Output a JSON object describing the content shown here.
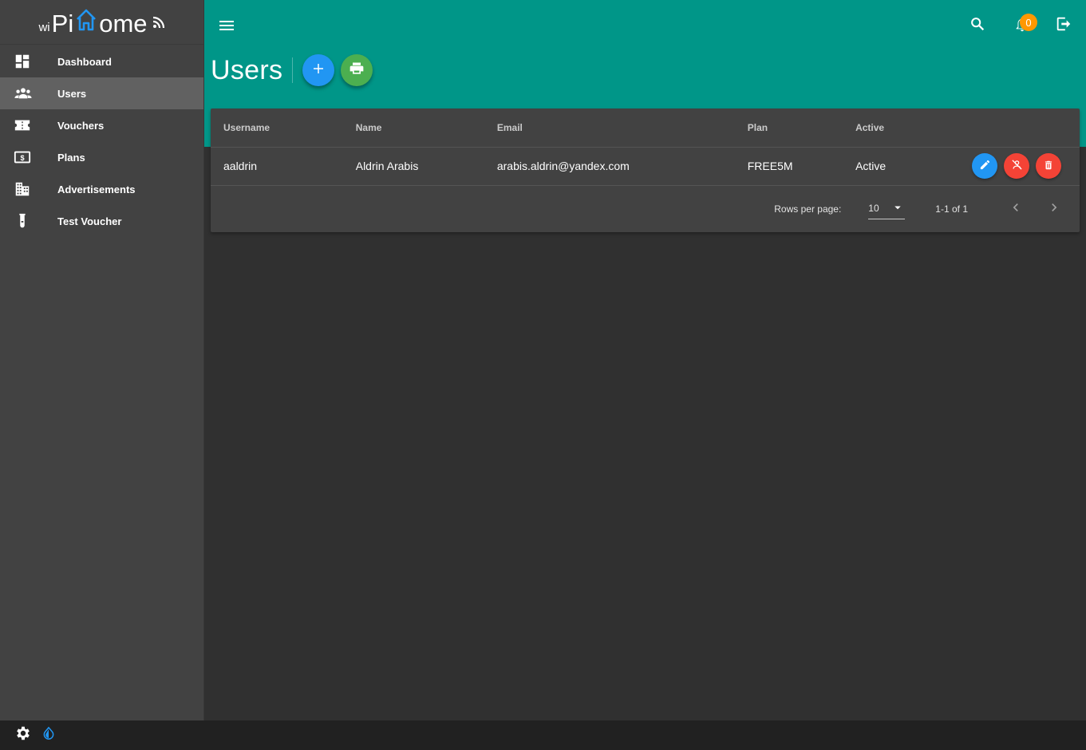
{
  "app": {
    "logo": {
      "prefix": "wi",
      "part1": "Pi",
      "part2": "ome"
    }
  },
  "sidebar": {
    "items": [
      {
        "label": "Dashboard",
        "icon": "dashboard-icon",
        "active": false
      },
      {
        "label": "Users",
        "icon": "users-icon",
        "active": true
      },
      {
        "label": "Vouchers",
        "icon": "voucher-icon",
        "active": false
      },
      {
        "label": "Plans",
        "icon": "money-icon",
        "active": false
      },
      {
        "label": "Advertisements",
        "icon": "building-icon",
        "active": false
      },
      {
        "label": "Test Voucher",
        "icon": "test-tube-icon",
        "active": false
      }
    ]
  },
  "header": {
    "notification_count": "0",
    "page_title": "Users"
  },
  "table": {
    "columns": [
      "Username",
      "Name",
      "Email",
      "Plan",
      "Active"
    ],
    "rows": [
      {
        "username": "aaldrin",
        "name": "Aldrin Arabis",
        "email": "arabis.aldrin@yandex.com",
        "plan": "FREE5M",
        "active": "Active"
      }
    ],
    "pagination": {
      "rows_per_page_label": "Rows per page:",
      "rows_per_page": "10",
      "range": "1-1 of 1"
    }
  },
  "colors": {
    "primary": "#009688",
    "fab_add": "#2196f3",
    "fab_print": "#4caf50",
    "action_edit": "#2196f3",
    "action_danger": "#f44336",
    "badge": "#ff9800",
    "logo_accent": "#2196f3"
  }
}
